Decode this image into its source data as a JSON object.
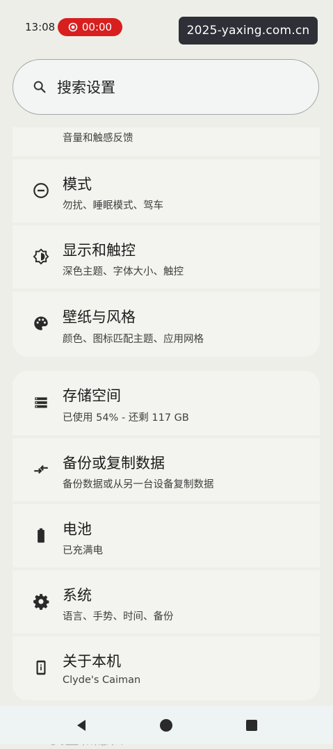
{
  "status_bar": {
    "time": "13:08",
    "recording_timer": "00:00",
    "accent_red": "#d71f1f"
  },
  "watermark": {
    "text": "2025-yaxing.com.cn"
  },
  "search": {
    "placeholder": "搜索设置",
    "icon": "search-icon"
  },
  "items": [
    {
      "icon": "volume-icon",
      "title": "",
      "subtitle": "音量和触感反馈"
    },
    {
      "icon": "mode-icon",
      "title": "模式",
      "subtitle": "勿扰、睡眠模式、驾车"
    },
    {
      "icon": "display-icon",
      "title": "显示和触控",
      "subtitle": "深色主题、字体大小、触控"
    },
    {
      "icon": "palette-icon",
      "title": "壁纸与风格",
      "subtitle": "颜色、图标匹配主题、应用网格"
    },
    {
      "icon": "storage-icon",
      "title": "存储空间",
      "subtitle": "已使用 54% - 还剩 117 GB"
    },
    {
      "icon": "backup-transfer-icon",
      "title": "备份或复制数据",
      "subtitle": "备份数据或从另一台设备复制数据"
    },
    {
      "icon": "battery-icon",
      "title": "电池",
      "subtitle": "已充满电"
    },
    {
      "icon": "gear-icon",
      "title": "系统",
      "subtitle": "语言、手势、时间、备份"
    },
    {
      "icon": "phone-info-icon",
      "title": "关于本机",
      "subtitle": "Clyde's Caiman"
    },
    {
      "icon": "security-icon",
      "title": "安全和隐私",
      "subtitle": ""
    }
  ],
  "nav": {
    "back": "back-icon",
    "home": "home-icon",
    "recents": "recents-icon"
  }
}
